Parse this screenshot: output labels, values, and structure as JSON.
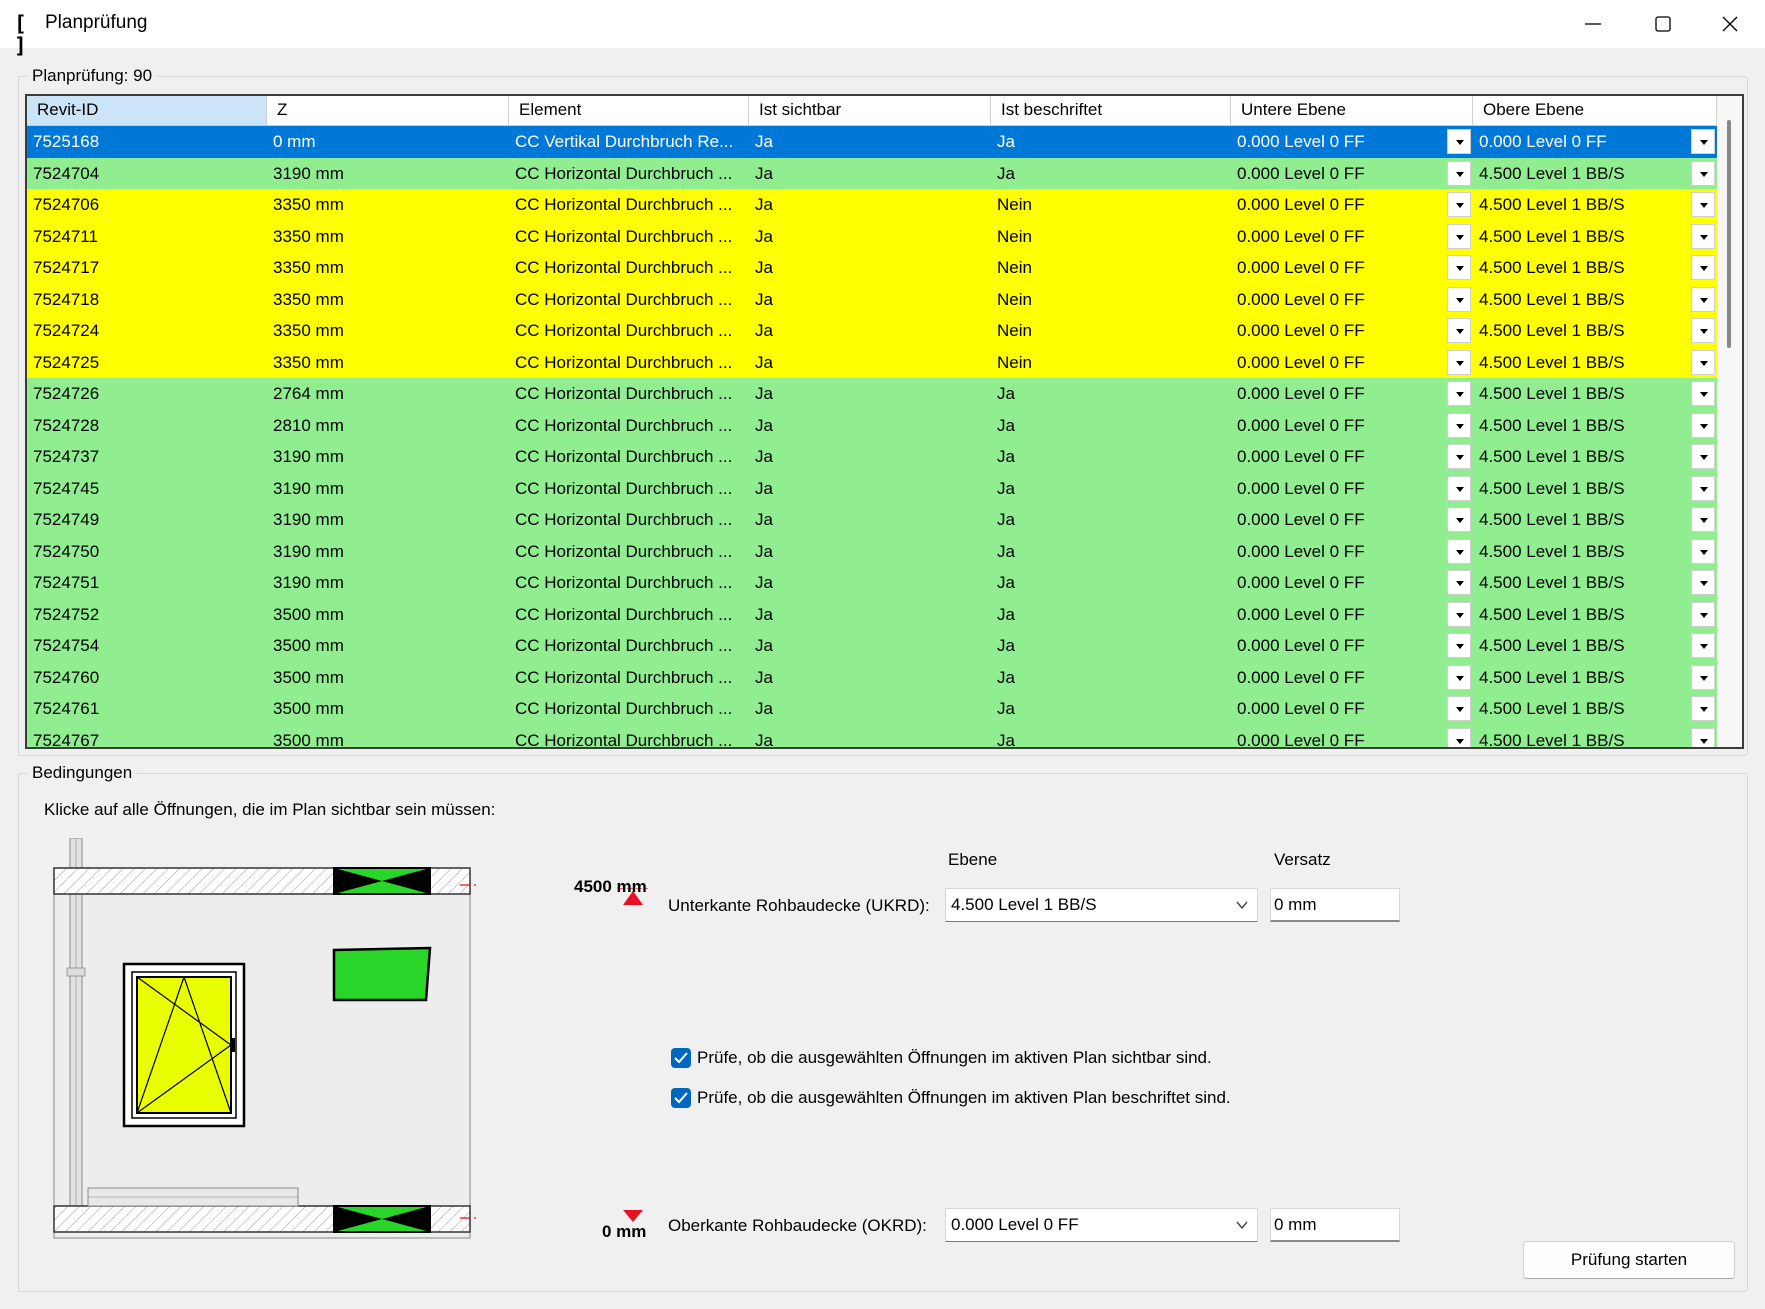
{
  "window": {
    "title": "Planprüfung"
  },
  "check_group": {
    "label": "Planprüfung: 90"
  },
  "grid": {
    "columns": [
      "Revit-ID",
      "Z",
      "Element",
      "Ist sichtbar",
      "Ist beschriftet",
      "Untere Ebene",
      "Obere Ebene"
    ],
    "rows": [
      {
        "id": "7525168",
        "z": "0 mm",
        "element": "CC Vertikal Durchbruch Re...",
        "visible": "Ja",
        "labeled": "Ja",
        "lower": "0.000  Level 0 FF",
        "upper": "0.000  Level 0 FF",
        "status": "selected"
      },
      {
        "id": "7524704",
        "z": "3190 mm",
        "element": "CC Horizontal Durchbruch ...",
        "visible": "Ja",
        "labeled": "Ja",
        "lower": "0.000  Level 0 FF",
        "upper": "4.500  Level 1 BB/S",
        "status": "ok"
      },
      {
        "id": "7524706",
        "z": "3350 mm",
        "element": "CC Horizontal Durchbruch ...",
        "visible": "Ja",
        "labeled": "Nein",
        "lower": "0.000  Level 0 FF",
        "upper": "4.500  Level 1 BB/S",
        "status": "warn"
      },
      {
        "id": "7524711",
        "z": "3350 mm",
        "element": "CC Horizontal Durchbruch ...",
        "visible": "Ja",
        "labeled": "Nein",
        "lower": "0.000  Level 0 FF",
        "upper": "4.500  Level 1 BB/S",
        "status": "warn"
      },
      {
        "id": "7524717",
        "z": "3350 mm",
        "element": "CC Horizontal Durchbruch ...",
        "visible": "Ja",
        "labeled": "Nein",
        "lower": "0.000  Level 0 FF",
        "upper": "4.500  Level 1 BB/S",
        "status": "warn"
      },
      {
        "id": "7524718",
        "z": "3350 mm",
        "element": "CC Horizontal Durchbruch ...",
        "visible": "Ja",
        "labeled": "Nein",
        "lower": "0.000  Level 0 FF",
        "upper": "4.500  Level 1 BB/S",
        "status": "warn"
      },
      {
        "id": "7524724",
        "z": "3350 mm",
        "element": "CC Horizontal Durchbruch ...",
        "visible": "Ja",
        "labeled": "Nein",
        "lower": "0.000  Level 0 FF",
        "upper": "4.500  Level 1 BB/S",
        "status": "warn"
      },
      {
        "id": "7524725",
        "z": "3350 mm",
        "element": "CC Horizontal Durchbruch ...",
        "visible": "Ja",
        "labeled": "Nein",
        "lower": "0.000  Level 0 FF",
        "upper": "4.500  Level 1 BB/S",
        "status": "warn"
      },
      {
        "id": "7524726",
        "z": "2764 mm",
        "element": "CC Horizontal Durchbruch ...",
        "visible": "Ja",
        "labeled": "Ja",
        "lower": "0.000  Level 0 FF",
        "upper": "4.500  Level 1 BB/S",
        "status": "ok"
      },
      {
        "id": "7524728",
        "z": "2810 mm",
        "element": "CC Horizontal Durchbruch ...",
        "visible": "Ja",
        "labeled": "Ja",
        "lower": "0.000  Level 0 FF",
        "upper": "4.500  Level 1 BB/S",
        "status": "ok"
      },
      {
        "id": "7524737",
        "z": "3190 mm",
        "element": "CC Horizontal Durchbruch ...",
        "visible": "Ja",
        "labeled": "Ja",
        "lower": "0.000  Level 0 FF",
        "upper": "4.500  Level 1 BB/S",
        "status": "ok"
      },
      {
        "id": "7524745",
        "z": "3190 mm",
        "element": "CC Horizontal Durchbruch ...",
        "visible": "Ja",
        "labeled": "Ja",
        "lower": "0.000  Level 0 FF",
        "upper": "4.500  Level 1 BB/S",
        "status": "ok"
      },
      {
        "id": "7524749",
        "z": "3190 mm",
        "element": "CC Horizontal Durchbruch ...",
        "visible": "Ja",
        "labeled": "Ja",
        "lower": "0.000  Level 0 FF",
        "upper": "4.500  Level 1 BB/S",
        "status": "ok"
      },
      {
        "id": "7524750",
        "z": "3190 mm",
        "element": "CC Horizontal Durchbruch ...",
        "visible": "Ja",
        "labeled": "Ja",
        "lower": "0.000  Level 0 FF",
        "upper": "4.500  Level 1 BB/S",
        "status": "ok"
      },
      {
        "id": "7524751",
        "z": "3190 mm",
        "element": "CC Horizontal Durchbruch ...",
        "visible": "Ja",
        "labeled": "Ja",
        "lower": "0.000  Level 0 FF",
        "upper": "4.500  Level 1 BB/S",
        "status": "ok"
      },
      {
        "id": "7524752",
        "z": "3500 mm",
        "element": "CC Horizontal Durchbruch ...",
        "visible": "Ja",
        "labeled": "Ja",
        "lower": "0.000  Level 0 FF",
        "upper": "4.500  Level 1 BB/S",
        "status": "ok"
      },
      {
        "id": "7524754",
        "z": "3500 mm",
        "element": "CC Horizontal Durchbruch ...",
        "visible": "Ja",
        "labeled": "Ja",
        "lower": "0.000  Level 0 FF",
        "upper": "4.500  Level 1 BB/S",
        "status": "ok"
      },
      {
        "id": "7524760",
        "z": "3500 mm",
        "element": "CC Horizontal Durchbruch ...",
        "visible": "Ja",
        "labeled": "Ja",
        "lower": "0.000  Level 0 FF",
        "upper": "4.500  Level 1 BB/S",
        "status": "ok"
      },
      {
        "id": "7524761",
        "z": "3500 mm",
        "element": "CC Horizontal Durchbruch ...",
        "visible": "Ja",
        "labeled": "Ja",
        "lower": "0.000  Level 0 FF",
        "upper": "4.500  Level 1 BB/S",
        "status": "ok"
      },
      {
        "id": "7524767",
        "z": "3500 mm",
        "element": "CC Horizontal Durchbruch ...",
        "visible": "Ja",
        "labeled": "Ja",
        "lower": "0.000  Level 0 FF",
        "upper": "4.500  Level 1 BB/S",
        "status": "ok"
      }
    ]
  },
  "colors": {
    "selected": "#0078d7",
    "ok": "#90ee90",
    "warn": "#ffff00",
    "accent": "#0067c0",
    "marker_red": "#e81123",
    "opening_green": "#2ad52a"
  },
  "conditions": {
    "label": "Bedingungen",
    "instruction": "Klicke auf alle Öffnungen, die im Plan sichtbar sein müssen:",
    "col_level": "Ebene",
    "col_offset": "Versatz",
    "top_dim": "4500 mm",
    "bottom_dim": "0 mm",
    "ukrd_label": "Unterkante Rohbaudecke (UKRD):",
    "ukrd_level": "4.500  Level 1 BB/S",
    "ukrd_offset": "0 mm",
    "okrd_label": "Oberkante Rohbaudecke (OKRD):",
    "okrd_level": "0.000  Level 0 FF",
    "okrd_offset": "0 mm",
    "check_visible": "Prüfe, ob die ausgewählten Öffnungen im aktiven Plan sichtbar sind.",
    "check_labeled": "Prüfe, ob die ausgewählten Öffnungen im aktiven Plan beschriftet sind.",
    "check_visible_checked": true,
    "check_labeled_checked": true
  },
  "actions": {
    "start_label": "Prüfung starten"
  },
  "icons": [
    "app-bracket-icon",
    "minimize-icon",
    "maximize-icon",
    "close-icon",
    "chevron-down-icon",
    "checkbox-checked-icon"
  ]
}
